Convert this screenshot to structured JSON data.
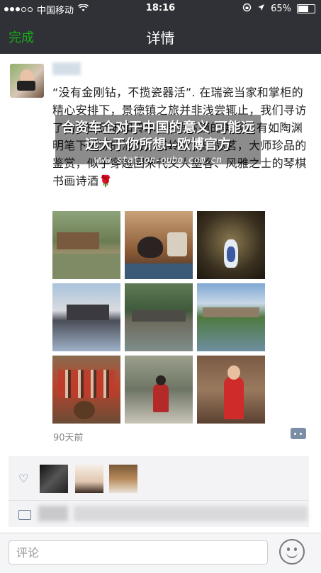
{
  "status_bar": {
    "carrier": "中国移动",
    "time": "18:16",
    "battery_text": "65%",
    "battery_level": 0.65
  },
  "nav": {
    "done_label": "完成",
    "title": "详情"
  },
  "post": {
    "text": "“没有金刚钻，不揽瓷器活”. 在瑞瓷当家和掌柜的精心安排下，景德镇之旅并非浅尝辄止，我们寻访了陶瓷的历史和传承. 瑶里古镇的美景，有如陶渊明笔下桃源的清雅，高岭枫学的品茗，大师珍品的鉴赏，似乎穿越回宋代文人墨客、风雅之士的琴棋书画诗酒🌹",
    "watermark_line1": "合资车企对于中国的意义 可能远远大于你所想--欧博官方",
    "watermark_line2": "www.station-oubo.com.cn",
    "time_ago": "90天前",
    "photo_count": 9
  },
  "comment_input": {
    "placeholder": "评论"
  },
  "icons": {
    "signal": "signal-dots-icon",
    "wifi": "wifi-icon",
    "lock_rotation": "rotation-lock-icon",
    "location": "location-arrow-icon",
    "battery": "battery-icon",
    "heart": "heart-icon",
    "comment": "comment-icon",
    "more": "comment-toggle-icon",
    "emoji": "emoji-icon"
  },
  "colors": {
    "nav_bg": "#2f3136",
    "done_green": "#1aad19",
    "link_blue": "#6a7f98"
  }
}
